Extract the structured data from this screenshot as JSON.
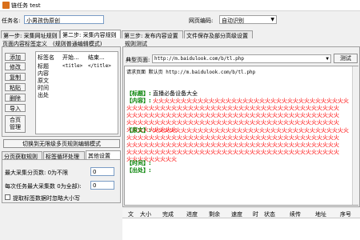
{
  "window": {
    "title": "链任务 test"
  },
  "top": {
    "task_name_label": "任务名:",
    "task_name_value": "小男孩伪原创",
    "encoding_label": "网页编码:",
    "encoding_value": "自动识别"
  },
  "tabs": [
    {
      "label": "第一步: 采集网址规则"
    },
    {
      "label": "第二步: 采集内容规则"
    },
    {
      "label": "第三步: 发布内容设置"
    },
    {
      "label": "文件保存及部分高级设置"
    }
  ],
  "left": {
    "section_title": "页面内容标签定义",
    "section_hint": "(规则普通编辑模式)",
    "buttons": [
      "添加",
      "修改",
      "复制",
      "粘贴",
      "删除",
      "导入"
    ],
    "merge_button": [
      "合页",
      "管理"
    ],
    "grid_headers": [
      "标签名",
      "开始...",
      "结束..."
    ],
    "grid_rows": [
      {
        "name": "标题",
        "start": "<title>",
        "end": "</title>"
      },
      {
        "name": "内容",
        "start": "",
        "end": ""
      },
      {
        "name": "原文",
        "start": "",
        "end": ""
      },
      {
        "name": "时间",
        "start": "",
        "end": ""
      },
      {
        "name": "出处",
        "start": "",
        "end": ""
      }
    ],
    "switch_button": "切换到无限级多页规则编辑模式",
    "subtabs": [
      "分页获取规则",
      "标签循环处理",
      "其他设置"
    ],
    "max_pages_label": "最大采集分页数: 0为不限",
    "max_pages_value": "0",
    "max_per_task_label": "每次任务最大采集数 0为全部):",
    "max_per_task_value": "0",
    "ignore_case_label": "提取标签数据时忽略大小写"
  },
  "right": {
    "section_title": "规则测试",
    "page_label": "典型页面:",
    "page_url": "http://m.baidulook.com/b/tl.php",
    "test_button": "测试",
    "request_line": "请求页面 默认页 http://m.baidulook.com/b/tl.php",
    "title_tag": "【标题】:",
    "title_value": "直播必备设备大全",
    "content_tag": "【内容】:",
    "content_lines": [
      "火火火火火火火火火火火火火火火火火火火火火火火火火火火火火火火火火火火",
      "火火火火火火火火火火火火火火火火火火火火火火火火火火火火火火火火火火火火火火",
      "火火火火火火火火火火火火火火火火火火火火火火火火火火火火火火火火火火火火火火",
      "火火火火火火火火火火火火火火火火火火火火火火火火火火火火火火火火火火火火火火",
      "火火火火火火火火火"
    ],
    "original_tag": "【原文】:",
    "original_lines": [
      "火火火火火火火火火火火火火火火火火火火火火火火火火火火火火火火火火火火",
      "火火火火火火火火火火火火火火火火火火火火火火火火火火火火火火火火火火火火火火",
      "火火火火火火火火火火火火火火火火火火火火火火火火火火火火火火火火火火火火火火",
      "火火火火火火火火火火火火火火火火火火火火火火火火火火火火火火火火火火火火火火",
      "火火火火火火火火火"
    ],
    "time_tag": "【时间】:",
    "source_tag": "【出处】:"
  },
  "statusbar": [
    "文",
    "大小",
    "完成",
    "进度",
    "剩余",
    "速度",
    "时",
    "状态",
    "续传",
    "地址",
    "序号"
  ],
  "colors": {
    "accent_red": "#ff0000",
    "tag_green": "#008000",
    "input_border": "#7a9cc5"
  }
}
